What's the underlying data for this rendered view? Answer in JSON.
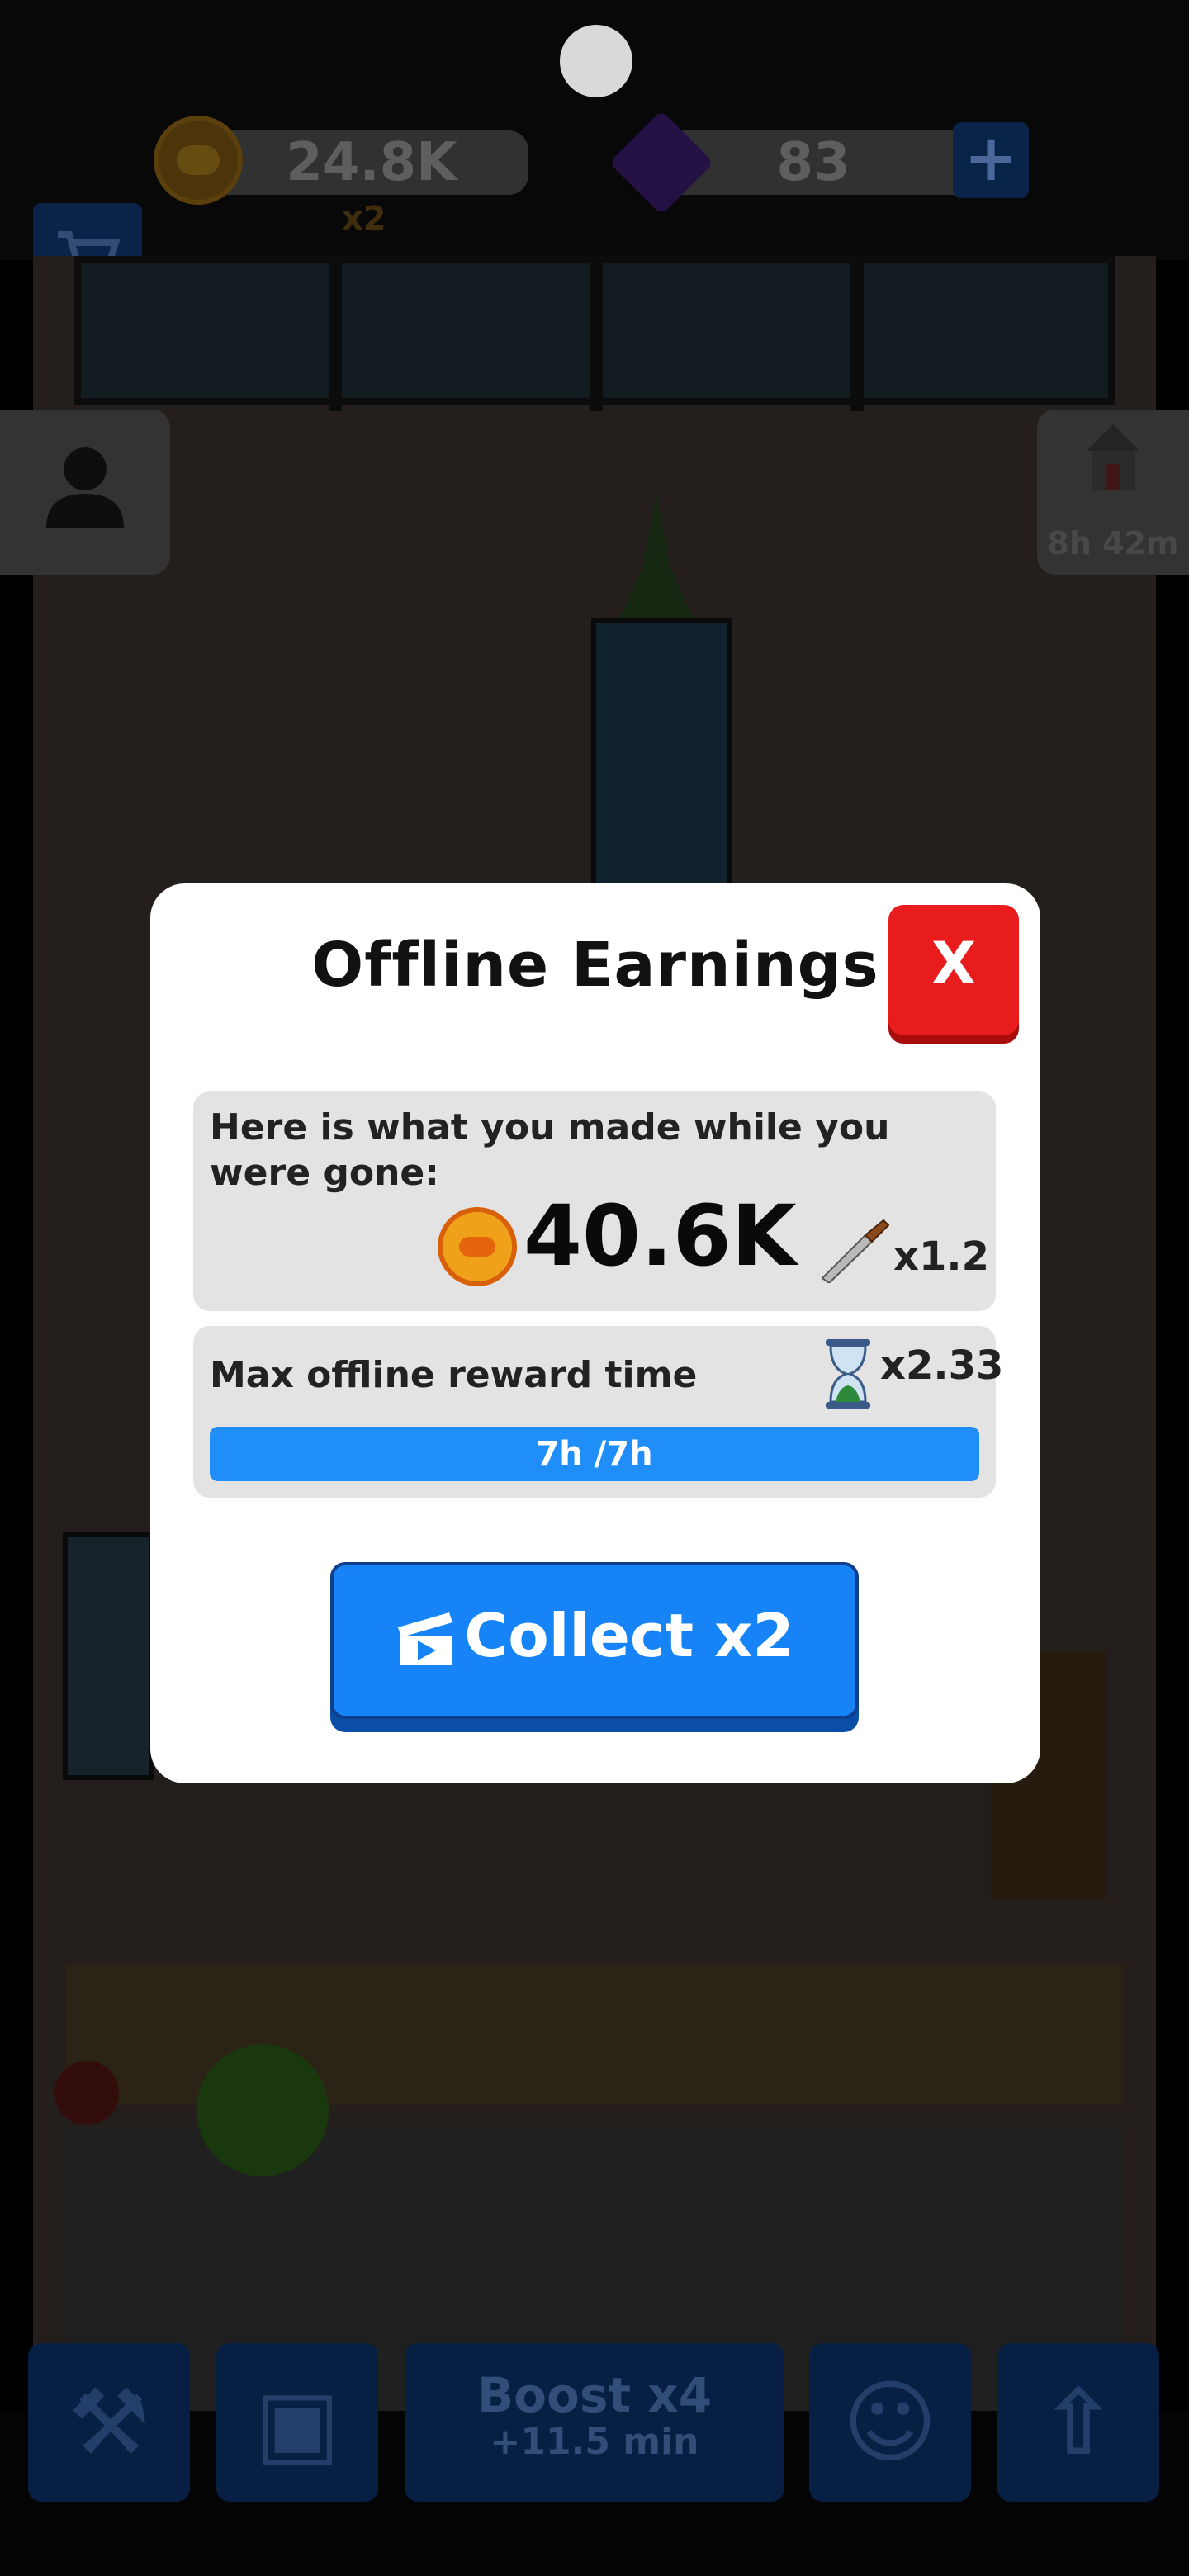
{
  "topbar": {
    "coins": "24.8K",
    "coin_multiplier": "x2",
    "gems": "83",
    "plus_label": "+",
    "cart_icon": "cart-icon"
  },
  "scene": {
    "timer": "8h 42m",
    "profile_icon": "user-icon"
  },
  "bottom_nav": {
    "boost_title": "Boost x4",
    "boost_sub": "+11.5 min"
  },
  "modal": {
    "title": "Offline Earnings",
    "close_label": "X",
    "earn_text": "Here is what you made while you were gone:",
    "earn_amount": "40.6K",
    "knife_multiplier": "x1.2",
    "time_label": "Max offline reward time",
    "time_multiplier": "x2.33",
    "progress_text": "7h /7h",
    "progress_fraction": 1.0,
    "collect_label": "Collect x2"
  },
  "colors": {
    "accent_blue": "#1684f6",
    "close_red": "#e81c1c",
    "coin_orange": "#f0a11a"
  }
}
